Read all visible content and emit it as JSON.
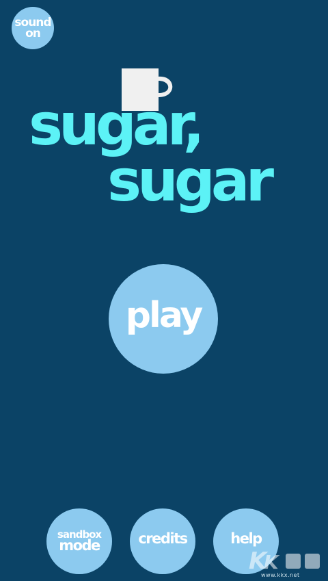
{
  "sound_button": {
    "line1": "sound",
    "line2": "on"
  },
  "title": {
    "line1": "sugar,",
    "line2": "sugar"
  },
  "play_button": {
    "label": "play"
  },
  "bottom_menu": {
    "sandbox_line1": "sandbox",
    "sandbox_line2": "mode",
    "credits": "credits",
    "help": "help"
  },
  "watermark": {
    "url": "www.kkx.net"
  },
  "colors": {
    "background": "#0b4366",
    "title": "#5cf2f6",
    "button": "#8ccaef",
    "button_text": "#ffffff",
    "cup": "#f0f0f0"
  },
  "icons": {
    "cup": "cup-icon",
    "watermark": "kkx-logo-icon"
  }
}
